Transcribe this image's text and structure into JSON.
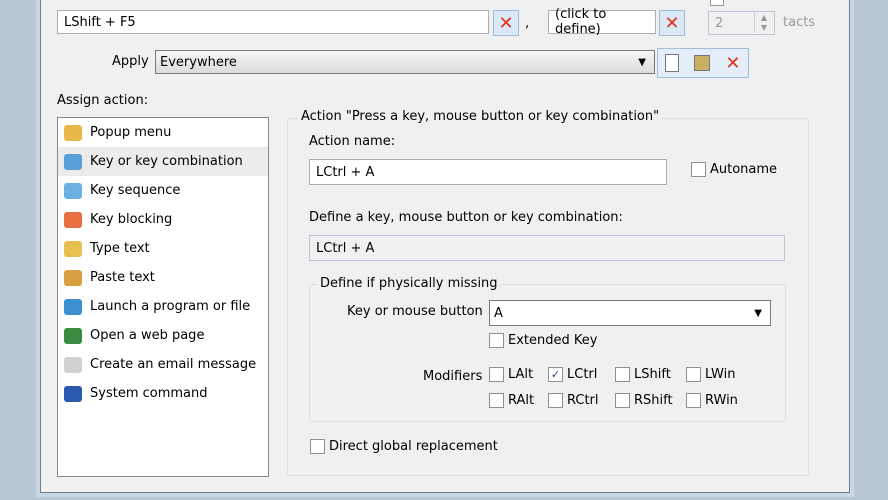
{
  "hotkey": {
    "primary": "LShift + F5",
    "separator": ",",
    "secondary": "(click to define)",
    "tacts_value": "2",
    "tacts_label": "tacts"
  },
  "apply": {
    "label": "Apply",
    "value": "Everywhere"
  },
  "assign": {
    "label": "Assign action:",
    "items": [
      {
        "label": "Popup menu",
        "color": "#e8b84a"
      },
      {
        "label": "Key or key combination",
        "color": "#5aa0d8",
        "selected": true
      },
      {
        "label": "Key sequence",
        "color": "#6ab0e0"
      },
      {
        "label": "Key blocking",
        "color": "#e87040"
      },
      {
        "label": "Type text",
        "color": "#e8c050"
      },
      {
        "label": "Paste text",
        "color": "#d8a040"
      },
      {
        "label": "Launch a program or file",
        "color": "#3a90d0"
      },
      {
        "label": "Open a web page",
        "color": "#3a8a40"
      },
      {
        "label": "Create an email message",
        "color": "#d0d0d0"
      },
      {
        "label": "System command",
        "color": "#2a5ab0"
      }
    ]
  },
  "action": {
    "group_title": "Action \"Press a key, mouse button or key combination\"",
    "name_label": "Action name:",
    "name_value": "LCtrl + A",
    "autoname": "Autoname",
    "define_label": "Define a key, mouse button or key combination:",
    "define_value": "LCtrl + A",
    "missing_title": "Define if physically missing",
    "key_label": "Key or mouse button",
    "key_value": "A",
    "extended": "Extended Key",
    "modifiers_label": "Modifiers",
    "modifiers": [
      {
        "label": "LAlt",
        "checked": false
      },
      {
        "label": "LCtrl",
        "checked": true
      },
      {
        "label": "LShift",
        "checked": false
      },
      {
        "label": "LWin",
        "checked": false
      },
      {
        "label": "RAlt",
        "checked": false
      },
      {
        "label": "RCtrl",
        "checked": false
      },
      {
        "label": "RShift",
        "checked": false
      },
      {
        "label": "RWin",
        "checked": false
      }
    ],
    "direct": "Direct global replacement"
  }
}
